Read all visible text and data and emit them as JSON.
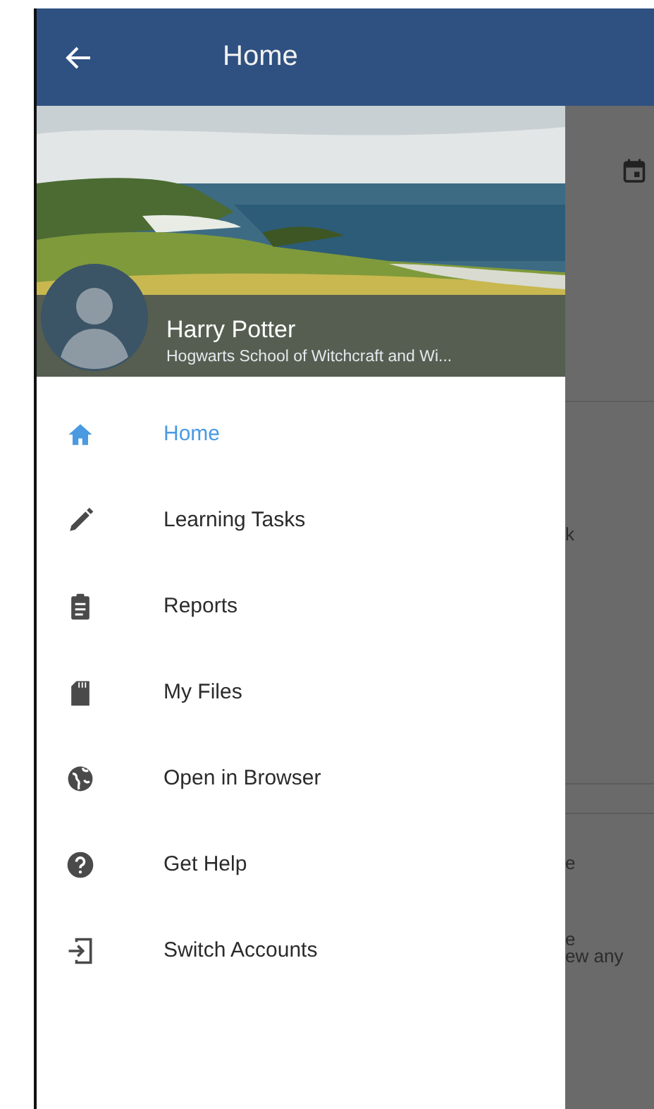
{
  "app_bar": {
    "title": "Home"
  },
  "drawer": {
    "profile": {
      "name": "Harry Potter",
      "school": "Hogwarts School of Witchcraft and Wi..."
    },
    "items": [
      {
        "label": "Home",
        "selected": true
      },
      {
        "label": "Learning Tasks",
        "selected": false
      },
      {
        "label": "Reports",
        "selected": false
      },
      {
        "label": "My Files",
        "selected": false
      },
      {
        "label": "Open in Browser",
        "selected": false
      },
      {
        "label": "Get Help",
        "selected": false
      },
      {
        "label": "Switch Accounts",
        "selected": false
      }
    ]
  },
  "background": {
    "texts": [
      "k",
      "e",
      "e",
      "ew any"
    ]
  }
}
